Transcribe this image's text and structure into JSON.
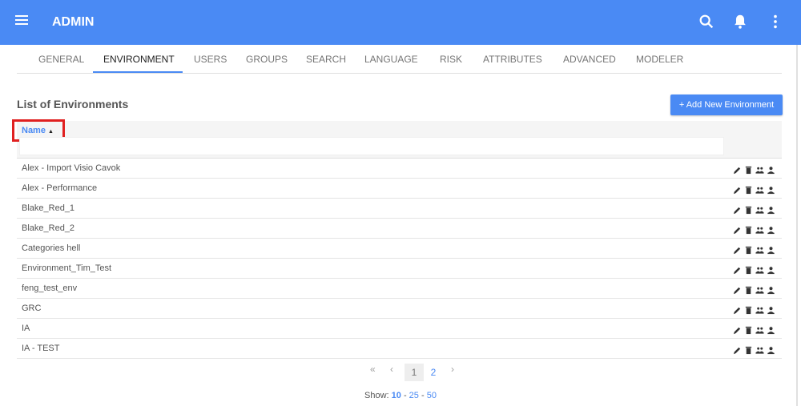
{
  "header": {
    "title": "ADMIN",
    "icons": [
      "menu-icon",
      "search-icon",
      "bell-icon",
      "more-vert-icon"
    ],
    "bg_color": "#4a8af4"
  },
  "tabs": [
    {
      "label": "GENERAL"
    },
    {
      "label": "ENVIRONMENT",
      "active": true
    },
    {
      "label": "USERS"
    },
    {
      "label": "GROUPS"
    },
    {
      "label": "SEARCH"
    },
    {
      "label": "LANGUAGE"
    },
    {
      "label": "RISK"
    },
    {
      "label": "ATTRIBUTES"
    },
    {
      "label": "ADVANCED"
    },
    {
      "label": "MODELER"
    }
  ],
  "main": {
    "title": "List of Environments",
    "add_button": "+ Add New Environment",
    "table": {
      "column_name": "Name",
      "sort": "ascending",
      "filter_placeholder": "",
      "rows": [
        "Alex - Import Visio Cavok",
        "Alex - Performance",
        "Blake_Red_1",
        "Blake_Red_2",
        "Categories hell",
        "Environment_Tim_Test",
        "feng_test_env",
        "GRC",
        "IA",
        "IA - TEST"
      ],
      "row_actions": [
        "edit-icon",
        "delete-icon",
        "groups-icon",
        "user-icon"
      ]
    },
    "pagination": {
      "first": "«",
      "prev": "‹",
      "pages": [
        "1",
        "2"
      ],
      "current": "1",
      "next": "›",
      "show_label": "Show:",
      "page_sizes": [
        "10",
        "25",
        "50"
      ],
      "selected_size": "10"
    }
  }
}
